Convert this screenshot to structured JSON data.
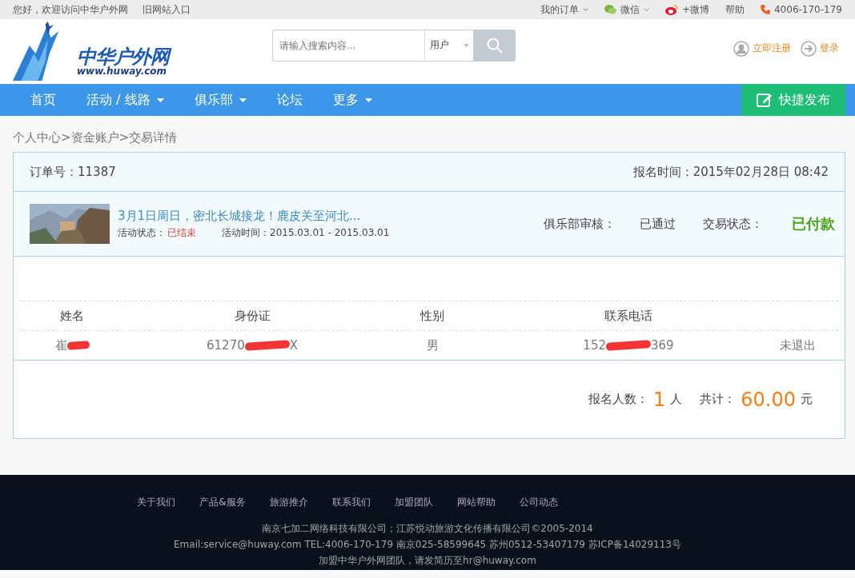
{
  "topbar": {
    "greeting": "您好，欢迎访问中华户外网",
    "old_site": "旧网站入口",
    "links": [
      {
        "kind": "dropdown",
        "label": "我的订单"
      },
      {
        "kind": "wechat",
        "label": "微信"
      },
      {
        "kind": "weibo",
        "label": "+微博"
      },
      {
        "kind": "plain",
        "label": "帮助"
      },
      {
        "kind": "phone",
        "label": "4006-170-179"
      }
    ]
  },
  "header": {
    "logo": {
      "name": "中华户外网",
      "url": "www.huway.com"
    },
    "search": {
      "placeholder": "请输入搜索内容...",
      "scope": "用户"
    },
    "register": "立即注册",
    "login": "登录"
  },
  "nav": {
    "items": [
      {
        "label": "首页",
        "dropdown": false
      },
      {
        "label": "活动 / 线路",
        "dropdown": true
      },
      {
        "label": "俱乐部",
        "dropdown": true
      },
      {
        "label": "论坛",
        "dropdown": false
      },
      {
        "label": "更多",
        "dropdown": true
      }
    ],
    "publish": "快捷发布"
  },
  "breadcrumb": "个人中心>资金账户>交易详情",
  "order": {
    "number_label": "订单号：",
    "number": "11387",
    "time_label": "报名时间：",
    "time": "2015年02月28日 08:42",
    "activity": {
      "title": "3月1日周日，密北长城接龙！鹿皮关至河北...",
      "status_label": "活动状态：",
      "status": "已结束",
      "time_label": "活动时间：",
      "time": "2015.03.01 - 2015.03.01"
    },
    "review_label": "俱乐部审核：",
    "review": "已通过",
    "trade_label": "交易状态：",
    "trade": "已付款"
  },
  "table": {
    "columns": [
      "姓名",
      "身份证",
      "性别",
      "联系电话"
    ],
    "rows": [
      {
        "cells": [
          {
            "parts": [
              "崔"
            ],
            "redacted": true
          },
          {
            "parts": [
              "61270",
              "X"
            ],
            "redacted": true
          },
          {
            "parts": [
              "男"
            ],
            "redacted": false
          },
          {
            "parts": [
              "152",
              "369"
            ],
            "redacted": true
          }
        ],
        "state": "未退出"
      }
    ]
  },
  "summary": {
    "count_label": "报名人数：",
    "count": "1",
    "count_unit": "人",
    "total_label": "共计：",
    "total": "60.00",
    "total_unit": "元"
  },
  "footer": {
    "links": [
      "关于我们",
      "产品&服务",
      "旅游推介",
      "联系我们",
      "加盟团队",
      "网站帮助",
      "公司动态"
    ],
    "lines": [
      "南京七加二网络科技有限公司；江苏悦动旅游文化传播有限公司©2005-2014",
      "Email:service@huway.com TEL:4006-170-179 南京025-58599645 苏州0512-53407179 苏ICP备14029113号",
      "加盟中华户外网团队，请发简历至hr@huway.com"
    ]
  }
}
